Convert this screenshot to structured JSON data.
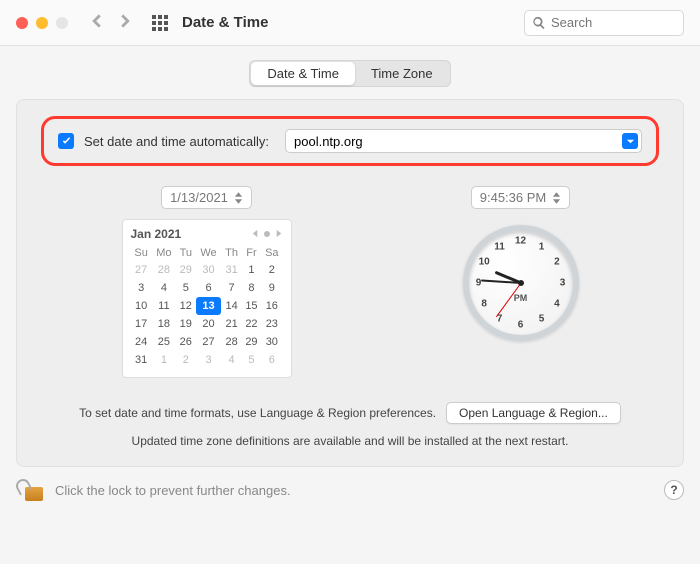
{
  "titlebar": {
    "traffic_colors": {
      "close": "#ff5f57",
      "min": "#febc2e",
      "max": "#e5e5e5"
    },
    "title": "Date & Time",
    "search_placeholder": "Search"
  },
  "tabs": {
    "date_time": "Date & Time",
    "time_zone": "Time Zone",
    "active": "date_time"
  },
  "auto": {
    "enabled": true,
    "label": "Set date and time automatically:",
    "server": "pool.ntp.org"
  },
  "date_field": "1/13/2021",
  "time_field": "9:45:36 PM",
  "calendar": {
    "month_label": "Jan 2021",
    "weekdays": [
      "Su",
      "Mo",
      "Tu",
      "We",
      "Th",
      "Fr",
      "Sa"
    ],
    "weeks": [
      [
        {
          "d": 27,
          "kind": "out"
        },
        {
          "d": 28,
          "kind": "out"
        },
        {
          "d": 29,
          "kind": "out"
        },
        {
          "d": 30,
          "kind": "out"
        },
        {
          "d": 31,
          "kind": "out"
        },
        {
          "d": 1,
          "kind": "cur"
        },
        {
          "d": 2,
          "kind": "cur"
        }
      ],
      [
        {
          "d": 3,
          "kind": "cur"
        },
        {
          "d": 4,
          "kind": "cur"
        },
        {
          "d": 5,
          "kind": "cur"
        },
        {
          "d": 6,
          "kind": "cur"
        },
        {
          "d": 7,
          "kind": "cur"
        },
        {
          "d": 8,
          "kind": "cur"
        },
        {
          "d": 9,
          "kind": "cur"
        }
      ],
      [
        {
          "d": 10,
          "kind": "cur"
        },
        {
          "d": 11,
          "kind": "cur"
        },
        {
          "d": 12,
          "kind": "cur"
        },
        {
          "d": 13,
          "kind": "today"
        },
        {
          "d": 14,
          "kind": "cur"
        },
        {
          "d": 15,
          "kind": "cur"
        },
        {
          "d": 16,
          "kind": "cur"
        }
      ],
      [
        {
          "d": 17,
          "kind": "cur"
        },
        {
          "d": 18,
          "kind": "cur"
        },
        {
          "d": 19,
          "kind": "cur"
        },
        {
          "d": 20,
          "kind": "cur"
        },
        {
          "d": 21,
          "kind": "cur"
        },
        {
          "d": 22,
          "kind": "cur"
        },
        {
          "d": 23,
          "kind": "cur"
        }
      ],
      [
        {
          "d": 24,
          "kind": "cur"
        },
        {
          "d": 25,
          "kind": "cur"
        },
        {
          "d": 26,
          "kind": "cur"
        },
        {
          "d": 27,
          "kind": "cur"
        },
        {
          "d": 28,
          "kind": "cur"
        },
        {
          "d": 29,
          "kind": "cur"
        },
        {
          "d": 30,
          "kind": "cur"
        }
      ],
      [
        {
          "d": 31,
          "kind": "cur"
        },
        {
          "d": 1,
          "kind": "out"
        },
        {
          "d": 2,
          "kind": "out"
        },
        {
          "d": 3,
          "kind": "out"
        },
        {
          "d": 4,
          "kind": "out"
        },
        {
          "d": 5,
          "kind": "out"
        },
        {
          "d": 6,
          "kind": "out"
        }
      ]
    ]
  },
  "clock": {
    "ampm": "PM",
    "hour_angle": 292.8,
    "minute_angle": 273.6,
    "second_angle": 216,
    "numerals": [
      "12",
      "1",
      "2",
      "3",
      "4",
      "5",
      "6",
      "7",
      "8",
      "9",
      "10",
      "11"
    ]
  },
  "footer": {
    "lang_text": "To set date and time formats, use Language & Region preferences.",
    "lang_button": "Open Language & Region...",
    "update_note": "Updated time zone definitions are available and will be installed at the next restart."
  },
  "lock": {
    "text": "Click the lock to prevent further changes.",
    "help": "?"
  }
}
